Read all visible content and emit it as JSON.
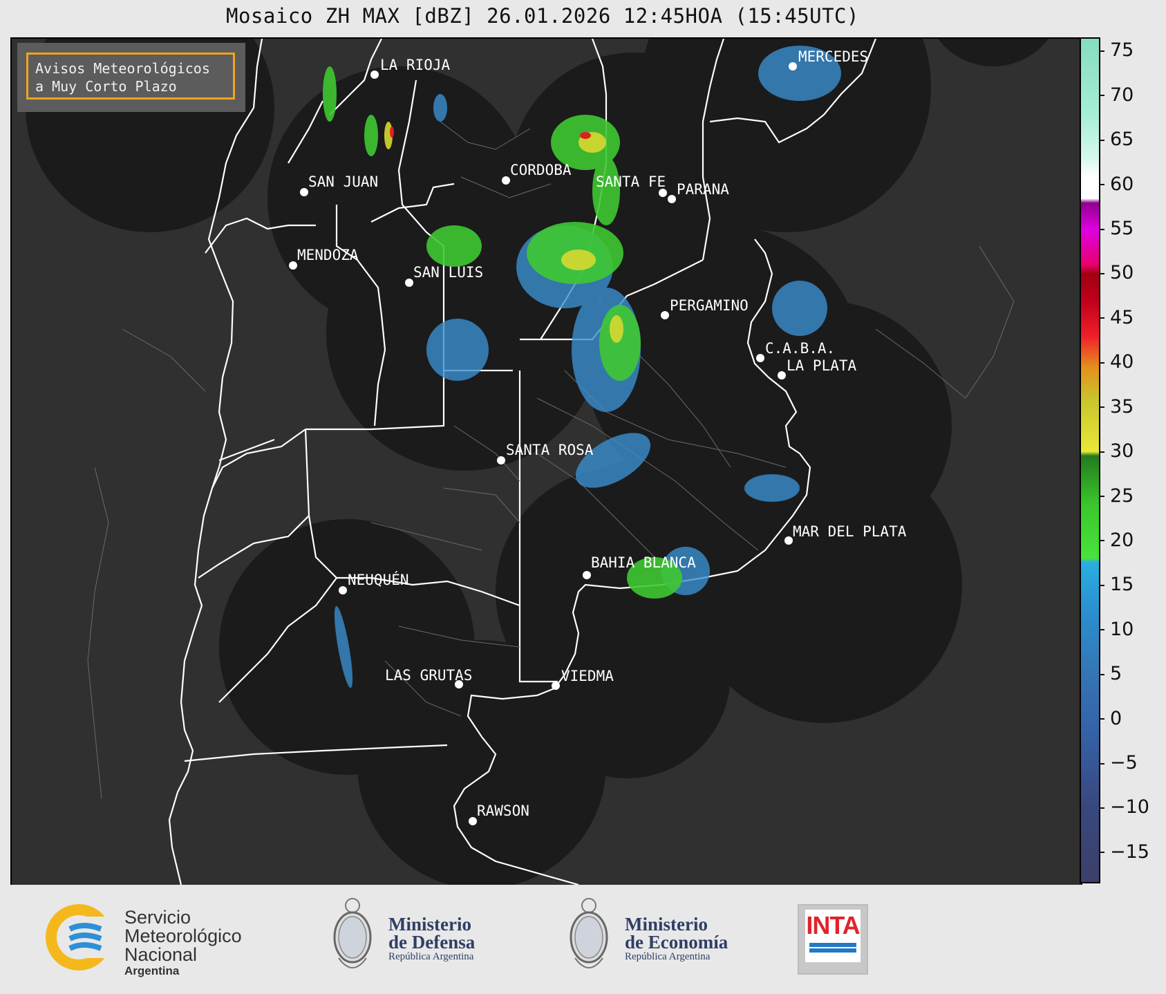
{
  "title": "Mosaico ZH MAX [dBZ] 26.01.2026 12:45HOA (15:45UTC)",
  "avisos": {
    "line1": "Avisos Meteorológicos",
    "line2": "a Muy Corto Plazo"
  },
  "cities": [
    {
      "name": "LA RIOJA"
    },
    {
      "name": "MERCEDES"
    },
    {
      "name": "CORDOBA"
    },
    {
      "name": "SAN JUAN"
    },
    {
      "name": "SANTA FE"
    },
    {
      "name": "PARANA"
    },
    {
      "name": "MENDOZA"
    },
    {
      "name": "SAN LUIS"
    },
    {
      "name": "PERGAMINO"
    },
    {
      "name": "C.A.B.A."
    },
    {
      "name": "LA PLATA"
    },
    {
      "name": "SANTA ROSA"
    },
    {
      "name": "MAR DEL PLATA"
    },
    {
      "name": "BAHIA BLANCA"
    },
    {
      "name": "NEUQUÉN"
    },
    {
      "name": "LAS GRUTAS"
    },
    {
      "name": "VIEDMA"
    },
    {
      "name": "RAWSON"
    }
  ],
  "colorbar": {
    "unit": "dBZ",
    "min": -18.5,
    "max": 76.5,
    "ticks": [
      "75",
      "70",
      "65",
      "60",
      "55",
      "50",
      "45",
      "40",
      "35",
      "30",
      "25",
      "20",
      "15",
      "10",
      "5",
      "0",
      "−5",
      "−10",
      "−15"
    ],
    "tick_values": [
      75,
      70,
      65,
      60,
      55,
      50,
      45,
      40,
      35,
      30,
      25,
      20,
      15,
      10,
      5,
      0,
      -5,
      -10,
      -15
    ]
  },
  "logos": {
    "smn": {
      "line1": "Servicio",
      "line2": "Meteorológico",
      "line3": "Nacional",
      "sub": "Argentina"
    },
    "defensa": {
      "line1": "Ministerio",
      "line2": "de Defensa",
      "sub": "República Argentina"
    },
    "economia": {
      "line1": "Ministerio",
      "line2": "de Economía",
      "sub": "República Argentina"
    },
    "inta": {
      "text": "INTA"
    }
  },
  "colors": {
    "radar_coverage": "#1b1b1b",
    "background": "#303030",
    "border_lines": "#ffffff",
    "avisos_border": "#f3a21c",
    "echo_blue": "#3a8fd0",
    "echo_green": "#3fc832",
    "echo_yellow": "#d8d830",
    "echo_red": "#e02020"
  }
}
